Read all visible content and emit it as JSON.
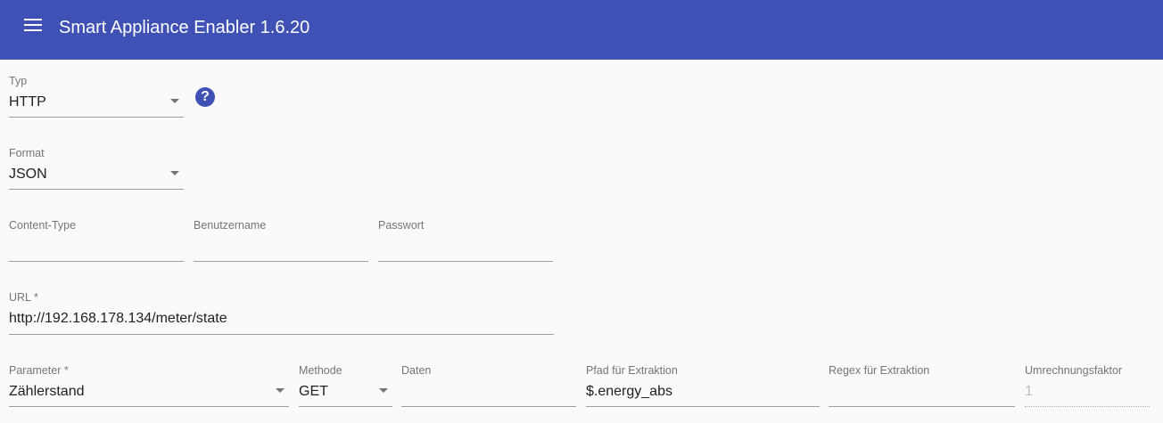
{
  "app": {
    "title": "Smart Appliance Enabler 1.6.20"
  },
  "typ": {
    "label": "Typ",
    "value": "HTTP"
  },
  "format": {
    "label": "Format",
    "value": "JSON"
  },
  "content_type": {
    "label": "Content-Type",
    "value": ""
  },
  "benutzername": {
    "label": "Benutzername",
    "value": ""
  },
  "passwort": {
    "label": "Passwort",
    "value": ""
  },
  "url": {
    "label": "URL *",
    "value": "http://192.168.178.134/meter/state"
  },
  "parameter": {
    "label": "Parameter *",
    "value": "Zählerstand"
  },
  "methode": {
    "label": "Methode",
    "value": "GET"
  },
  "daten": {
    "label": "Daten",
    "value": ""
  },
  "pfad": {
    "label": "Pfad für Extraktion",
    "value": "$.energy_abs"
  },
  "regex": {
    "label": "Regex für Extraktion",
    "value": ""
  },
  "umrechnungsfaktor": {
    "label": "Umrechnungsfaktor",
    "value": "1"
  },
  "icons": {
    "menu": "menu-icon",
    "help": "help-icon",
    "help_glyph": "?"
  },
  "colors": {
    "toolbar": "#3f51b5",
    "background": "#fafafa"
  }
}
